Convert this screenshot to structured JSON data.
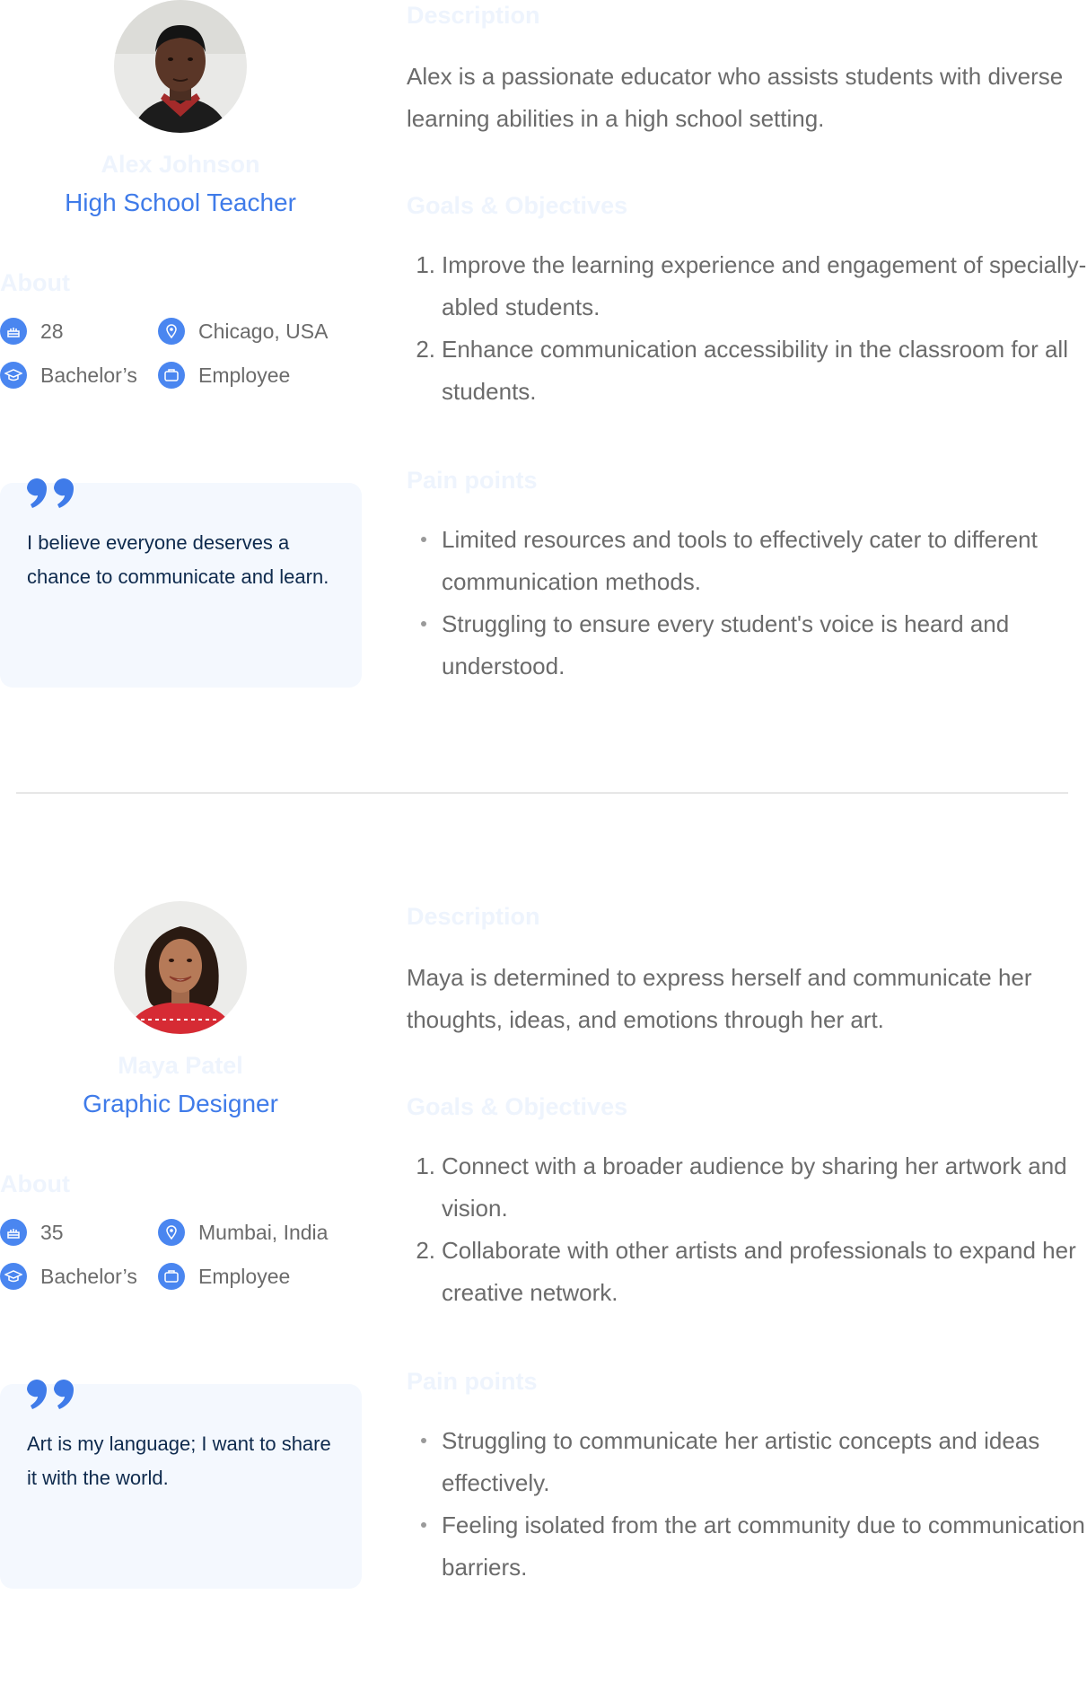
{
  "personas": [
    {
      "name": "Alex Johnson",
      "role": "High School Teacher",
      "about_label": "About",
      "facts": {
        "age": "28",
        "location": "Chicago, USA",
        "education": "Bachelor’s",
        "occupation": "Employee"
      },
      "quote": "I believe everyone deserves a chance to communicate and learn.",
      "description_label": "Description",
      "description": "Alex is a passionate educator who assists students with diverse learning abilities in a high school setting.",
      "goals_label": "Goals & Objectives",
      "goals": [
        {
          "num": "1.",
          "text": "Improve the learning experience and engagement of specially-abled students."
        },
        {
          "num": "2.",
          "text": "Enhance communication accessibility in the classroom for all students."
        }
      ],
      "pain_label": "Pain points",
      "pain_points": [
        "Limited resources and tools to effectively cater to different communication methods.",
        "Struggling to ensure every student's voice is heard and understood."
      ]
    },
    {
      "name": "Maya Patel",
      "role": "Graphic Designer",
      "about_label": "About",
      "facts": {
        "age": "35",
        "location": "Mumbai, India",
        "education": "Bachelor’s",
        "occupation": "Employee"
      },
      "quote": "Art is my language; I want to share it with the world.",
      "description_label": "Description",
      "description": "Maya is determined to express herself and communicate her thoughts, ideas, and emotions through her art.",
      "goals_label": "Goals & Objectives",
      "goals": [
        {
          "num": "1.",
          "text": "Connect with a broader audience by sharing her artwork and vision."
        },
        {
          "num": "2.",
          "text": "Collaborate with other artists and professionals to expand her creative network."
        }
      ],
      "pain_label": "Pain points",
      "pain_points": [
        "Struggling to communicate her artistic concepts and ideas effectively.",
        "Feeling isolated from the art community due to communication barriers."
      ]
    }
  ],
  "colors": {
    "accent": "#3f7be9",
    "icon_bg": "#4a86f0",
    "quote_bg": "#f4f8fe",
    "quote_text": "#0e2a4d",
    "faint_label": "#eef4fd",
    "body_text": "#6b6b6b"
  }
}
